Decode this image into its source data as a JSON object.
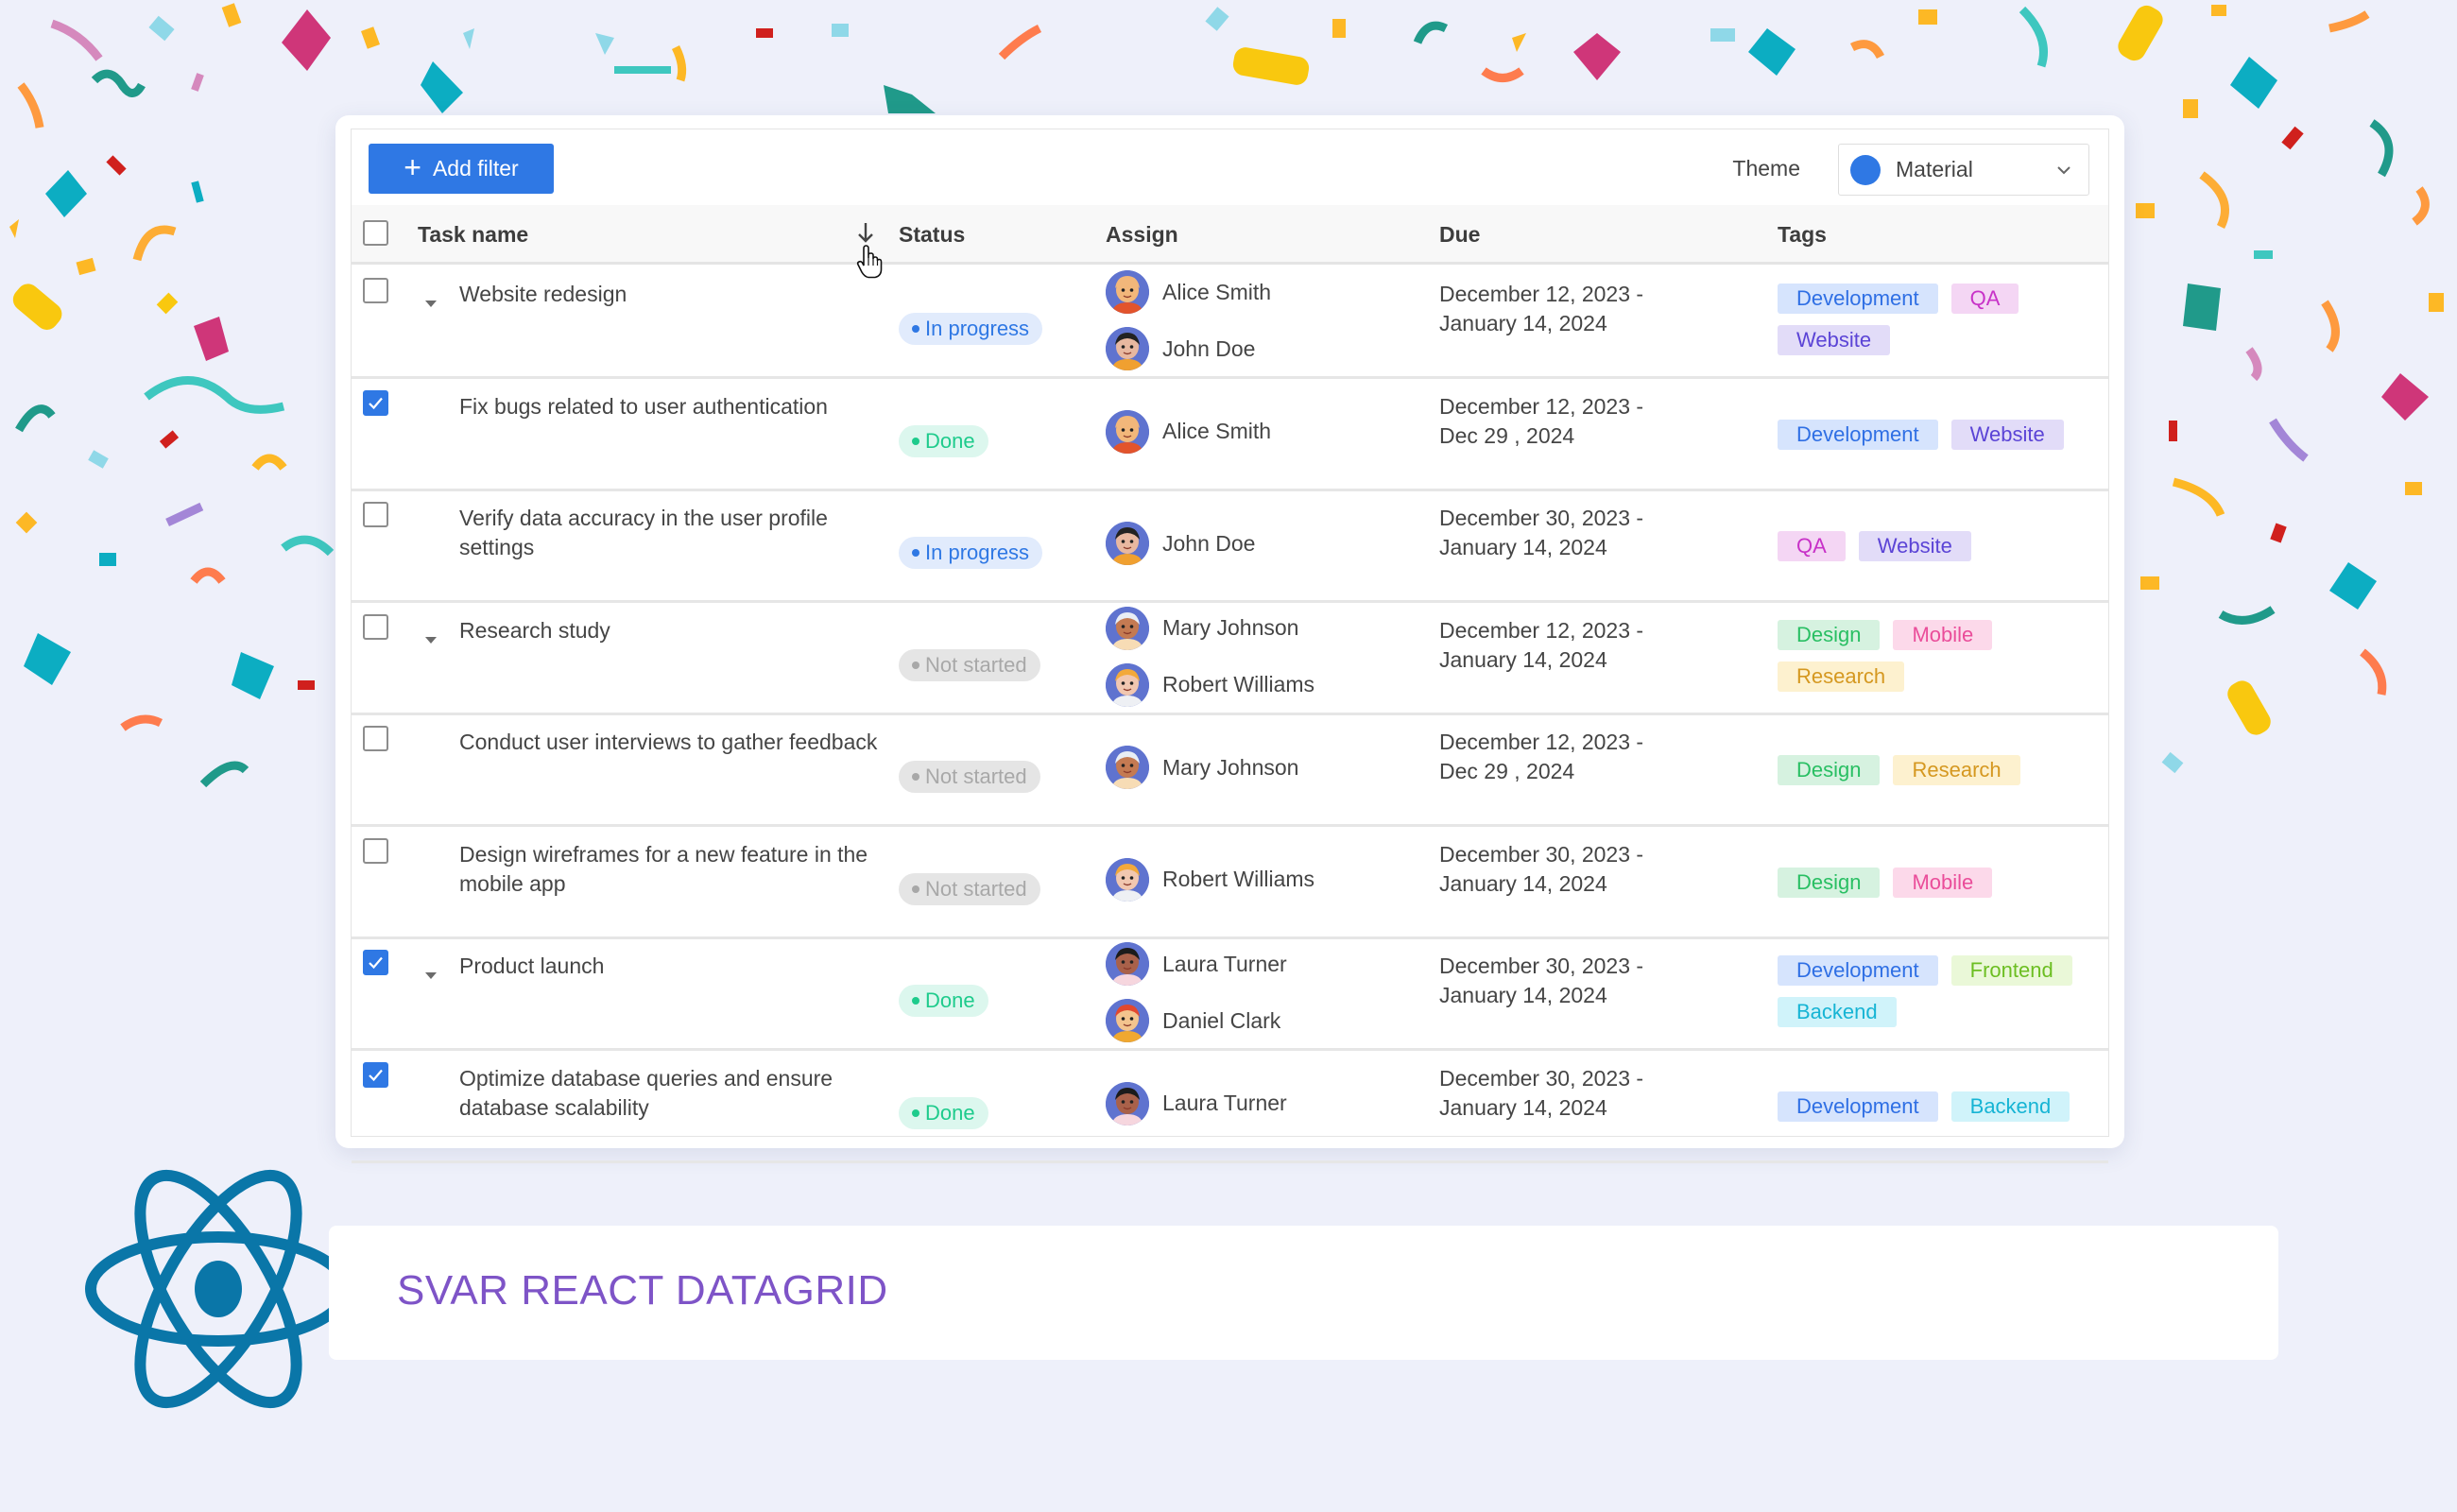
{
  "toolbar": {
    "add_filter_label": "Add filter",
    "add_filter_icon": "plus-icon",
    "theme_label": "Theme",
    "theme_value": "Material",
    "theme_color": "#2f78e4"
  },
  "columns": {
    "task_name": "Task name",
    "status": "Status",
    "assign": "Assign",
    "due": "Due",
    "tags": "Tags",
    "sort_icon": "arrow-down-icon",
    "sort_column": "Task name",
    "sort_direction": "descending"
  },
  "rows": [
    {
      "checked": false,
      "expandable": true,
      "task": "Website redesign",
      "status": "In progress",
      "assignees": [
        "Alice Smith",
        "John Doe"
      ],
      "due_line1": "December 12, 2023 -",
      "due_line2": "January 14, 2024",
      "tags": [
        "Development",
        "QA",
        "Website"
      ]
    },
    {
      "checked": true,
      "expandable": false,
      "task": "Fix bugs related to user authentication",
      "status": "Done",
      "assignees": [
        "Alice Smith"
      ],
      "due_line1": "December 12, 2023 -",
      "due_line2": "Dec 29 , 2024",
      "tags": [
        "Development",
        "Website"
      ]
    },
    {
      "checked": false,
      "expandable": false,
      "task": "Verify data accuracy in the user profile settings",
      "status": "In progress",
      "assignees": [
        "John Doe"
      ],
      "due_line1": "December 30, 2023 -",
      "due_line2": "January 14, 2024",
      "tags": [
        "QA",
        "Website"
      ]
    },
    {
      "checked": false,
      "expandable": true,
      "task": "Research study",
      "status": "Not started",
      "assignees": [
        "Mary Johnson",
        "Robert Williams"
      ],
      "due_line1": "December 12, 2023 -",
      "due_line2": "January 14, 2024",
      "tags": [
        "Design",
        "Mobile",
        "Research"
      ]
    },
    {
      "checked": false,
      "expandable": false,
      "task": "Conduct user interviews to gather feedback",
      "status": "Not started",
      "assignees": [
        "Mary Johnson"
      ],
      "due_line1": "December 12, 2023 -",
      "due_line2": "Dec 29 , 2024",
      "tags": [
        "Design",
        "Research"
      ]
    },
    {
      "checked": false,
      "expandable": false,
      "task": "Design wireframes for a new feature in the mobile app",
      "status": "Not started",
      "assignees": [
        "Robert Williams"
      ],
      "due_line1": "December 30, 2023 -",
      "due_line2": "January 14, 2024",
      "tags": [
        "Design",
        "Mobile"
      ]
    },
    {
      "checked": true,
      "expandable": true,
      "task": "Product launch",
      "status": "Done",
      "assignees": [
        "Laura Turner",
        "Daniel Clark"
      ],
      "due_line1": "December 30, 2023 -",
      "due_line2": "January 14, 2024",
      "tags": [
        "Development",
        "Frontend",
        "Backend"
      ]
    },
    {
      "checked": true,
      "expandable": false,
      "task": "Optimize database queries and ensure database scalability",
      "status": "Done",
      "assignees": [
        "Laura Turner"
      ],
      "due_line1": "December 30, 2023 -",
      "due_line2": "January 14, 2024",
      "tags": [
        "Development",
        "Backend"
      ]
    }
  ],
  "status_styles": {
    "In progress": {
      "bg": "#e1ebfc",
      "fg": "#2f78e4"
    },
    "Done": {
      "bg": "#dcf7ee",
      "fg": "#1ecb8c"
    },
    "Not started": {
      "bg": "#e5e5e5",
      "fg": "#a8a8a8"
    }
  },
  "tag_styles": {
    "Development": {
      "bg": "#d6e4fd",
      "fg": "#2f6fe4"
    },
    "QA": {
      "bg": "#f4d6f4",
      "fg": "#c832c8"
    },
    "Website": {
      "bg": "#e2dcf8",
      "fg": "#5b44d6"
    },
    "Design": {
      "bg": "#d6f2e0",
      "fg": "#29bf63"
    },
    "Mobile": {
      "bg": "#fcd9ea",
      "fg": "#ea4d9a"
    },
    "Research": {
      "bg": "#fdf1cf",
      "fg": "#d59820"
    },
    "Frontend": {
      "bg": "#eaf8d8",
      "fg": "#6cbe22"
    },
    "Backend": {
      "bg": "#d0f3fa",
      "fg": "#16b4d4"
    }
  },
  "avatars": {
    "Alice Smith": {
      "skin": "#f2b77a",
      "hair": "#f2b77a",
      "shirt": "#e2542c"
    },
    "John Doe": {
      "skin": "#e8b8a0",
      "hair": "#222222",
      "shirt": "#f0a030"
    },
    "Mary Johnson": {
      "skin": "#c47a52",
      "hair": "#e9eef5",
      "shirt": "#f7dcb5"
    },
    "Robert Williams": {
      "skin": "#f1c7b0",
      "hair": "#f2a93b",
      "shirt": "#eef0f4"
    },
    "Laura Turner": {
      "skin": "#a9614a",
      "hair": "#1b1b1b",
      "shirt": "#f6d6de"
    },
    "Daniel Clark": {
      "skin": "#f3c48e",
      "hair": "#e2482e",
      "shirt": "#f0a830"
    }
  },
  "banner": {
    "title": "SVAR REACT DATAGRID",
    "logo": "react-logo-icon",
    "logo_color": "#0a76a8",
    "title_color": "#7e54c7"
  }
}
